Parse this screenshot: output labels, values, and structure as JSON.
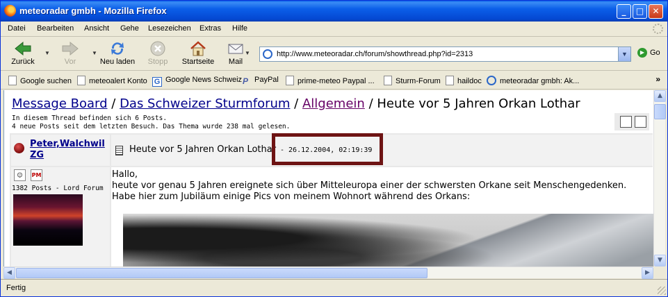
{
  "window": {
    "title": "meteoradar gmbh - Mozilla Firefox"
  },
  "menu": [
    "Datei",
    "Bearbeiten",
    "Ansicht",
    "Gehe",
    "Lesezeichen",
    "Extras",
    "Hilfe"
  ],
  "nav": {
    "back": "Zurück",
    "forward": "Vor",
    "reload": "Neu laden",
    "stop": "Stopp",
    "home": "Startseite",
    "mail": "Mail",
    "url": "http://www.meteoradar.ch/forum/showthread.php?id=2313",
    "go": "Go"
  },
  "bookmarks": [
    "Google suchen",
    "meteoalert Konto",
    "Google News Schweiz",
    "PayPal",
    "prime-meteo Paypal ...",
    "Sturm-Forum",
    "haildoc",
    "meteoradar gmbh: Ak..."
  ],
  "page": {
    "breadcrumb": {
      "board": "Message Board",
      "sep1": "/",
      "forum": "Das Schweizer Sturmforum",
      "sep2": "/",
      "category": "Allgemein",
      "sep3": "/",
      "thread": "Heute vor 5 Jahren Orkan Lothar"
    },
    "info_line1": "In diesem Thread befinden sich 6 Posts.",
    "info_line2": "4 neue Posts seit dem letzten Besuch. Das Thema wurde 238 mal gelesen.",
    "author": {
      "name": "Peter,Walchwil ZG",
      "posts": "1382 Posts - Lord Forum"
    },
    "post": {
      "subject": "Heute vor 5 Jahren Orkan Lothar",
      "date": "- 26.12.2004, 02:19:39",
      "line1": "Hallo,",
      "line2": "heute vor genau 5 Jahren ereignete sich über Mitteleuropa einer der schwersten Orkane seit Menschengedenken.",
      "line3": "Habe hier zum Jubiläum einige Pics von meinem Wohnort während des Orkans:"
    }
  },
  "status": "Fertig",
  "colors": {
    "titlebar": "#0a5fe8",
    "link": "#00008b",
    "highlight_box": "#6e1414"
  }
}
